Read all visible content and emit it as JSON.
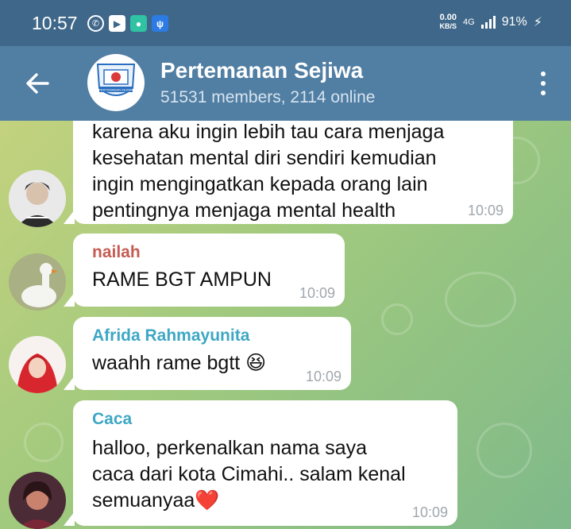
{
  "status_bar": {
    "time": "10:57",
    "speed_value": "0.00",
    "speed_unit": "KB/S",
    "network": "4G",
    "battery": "91%"
  },
  "header": {
    "title": "Pertemanan Sejiwa",
    "subtitle": "51531 members, 2114 online",
    "logo_text": "PERTEMANAN SEJIWA"
  },
  "messages": [
    {
      "sender": "",
      "lines": [
        "karena aku ingin lebih tau cara menjaga",
        "kesehatan mental diri sendiri kemudian",
        "ingin mengingatkan kepada orang lain",
        "pentingnya menjaga mental health"
      ],
      "time": "10:09"
    },
    {
      "sender": "nailah",
      "sender_color": "#c45c52",
      "text": "RAME BGT AMPUN",
      "time": "10:09"
    },
    {
      "sender": "Afrida Rahmayunita",
      "sender_color": "#3ea7c4",
      "text": "waahh rame bgtt 😆",
      "time": "10:09"
    },
    {
      "sender": "Caca",
      "sender_color": "#3ea7c4",
      "lines": [
        "halloo, perkenalkan nama saya",
        "caca dari kota Cimahi.. salam kenal",
        "semuanyaa❤️"
      ],
      "time": "10:09"
    }
  ],
  "colors": {
    "status_bar": "#3f6789",
    "app_bar": "#517ea3",
    "bubble": "#ffffff"
  }
}
